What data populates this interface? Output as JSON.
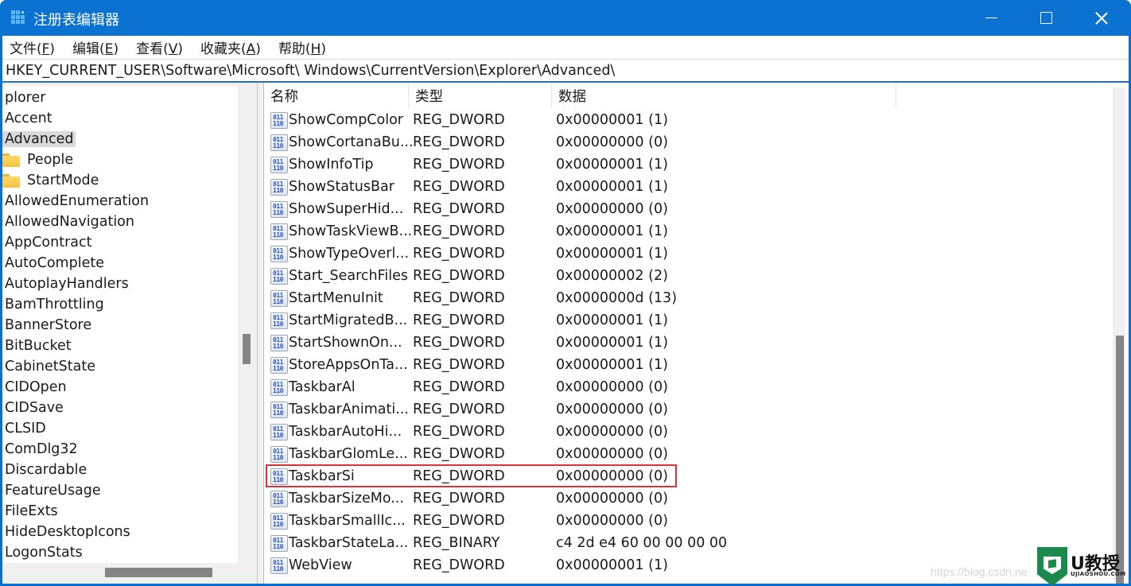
{
  "window": {
    "title": "注册表编辑器",
    "icon": "registry-editor-icon"
  },
  "menu": [
    {
      "label": "文件(",
      "key": "F",
      "suffix": ")"
    },
    {
      "label": "编辑(",
      "key": "E",
      "suffix": ")"
    },
    {
      "label": "查看(",
      "key": "V",
      "suffix": ")"
    },
    {
      "label": "收藏夹(",
      "key": "A",
      "suffix": ")"
    },
    {
      "label": "帮助(",
      "key": "H",
      "suffix": ")"
    }
  ],
  "address": "HKEY_CURRENT_USER\\Software\\Microsoft\\ Windows\\CurrentVersion\\Explorer\\Advanced\\",
  "tree": [
    {
      "label": "plorer",
      "folder": false,
      "selected": false
    },
    {
      "label": "Accent",
      "folder": false,
      "selected": false
    },
    {
      "label": "Advanced",
      "folder": false,
      "selected": true
    },
    {
      "label": "People",
      "folder": true,
      "selected": false
    },
    {
      "label": "StartMode",
      "folder": true,
      "selected": false
    },
    {
      "label": "AllowedEnumeration",
      "folder": false,
      "selected": false
    },
    {
      "label": "AllowedNavigation",
      "folder": false,
      "selected": false
    },
    {
      "label": "AppContract",
      "folder": false,
      "selected": false
    },
    {
      "label": "AutoComplete",
      "folder": false,
      "selected": false
    },
    {
      "label": "AutoplayHandlers",
      "folder": false,
      "selected": false
    },
    {
      "label": "BamThrottling",
      "folder": false,
      "selected": false
    },
    {
      "label": "BannerStore",
      "folder": false,
      "selected": false
    },
    {
      "label": "BitBucket",
      "folder": false,
      "selected": false
    },
    {
      "label": "CabinetState",
      "folder": false,
      "selected": false
    },
    {
      "label": "CIDOpen",
      "folder": false,
      "selected": false
    },
    {
      "label": "CIDSave",
      "folder": false,
      "selected": false
    },
    {
      "label": "CLSID",
      "folder": false,
      "selected": false
    },
    {
      "label": "ComDlg32",
      "folder": false,
      "selected": false
    },
    {
      "label": "Discardable",
      "folder": false,
      "selected": false
    },
    {
      "label": "FeatureUsage",
      "folder": false,
      "selected": false
    },
    {
      "label": "FileExts",
      "folder": false,
      "selected": false
    },
    {
      "label": "HideDesktopIcons",
      "folder": false,
      "selected": false
    },
    {
      "label": "LogonStats",
      "folder": false,
      "selected": false
    }
  ],
  "columns": {
    "name": "名称",
    "type": "类型",
    "data": "数据"
  },
  "values": [
    {
      "name": "ShowCompColor",
      "type": "REG_DWORD",
      "data": "0x00000001 (1)"
    },
    {
      "name": "ShowCortanaBu...",
      "type": "REG_DWORD",
      "data": "0x00000000 (0)"
    },
    {
      "name": "ShowInfoTip",
      "type": "REG_DWORD",
      "data": "0x00000001 (1)"
    },
    {
      "name": "ShowStatusBar",
      "type": "REG_DWORD",
      "data": "0x00000001 (1)"
    },
    {
      "name": "ShowSuperHid...",
      "type": "REG_DWORD",
      "data": "0x00000000 (0)"
    },
    {
      "name": "ShowTaskViewB...",
      "type": "REG_DWORD",
      "data": "0x00000001 (1)"
    },
    {
      "name": "ShowTypeOverl...",
      "type": "REG_DWORD",
      "data": "0x00000001 (1)"
    },
    {
      "name": "Start_SearchFiles",
      "type": "REG_DWORD",
      "data": "0x00000002 (2)"
    },
    {
      "name": "StartMenuInit",
      "type": "REG_DWORD",
      "data": "0x0000000d (13)"
    },
    {
      "name": "StartMigratedB...",
      "type": "REG_DWORD",
      "data": "0x00000001 (1)"
    },
    {
      "name": "StartShownOn...",
      "type": "REG_DWORD",
      "data": "0x00000001 (1)"
    },
    {
      "name": "StoreAppsOnTa...",
      "type": "REG_DWORD",
      "data": "0x00000001 (1)"
    },
    {
      "name": "TaskbarAl",
      "type": "REG_DWORD",
      "data": "0x00000000 (0)"
    },
    {
      "name": "TaskbarAnimati...",
      "type": "REG_DWORD",
      "data": "0x00000000 (0)"
    },
    {
      "name": "TaskbarAutoHi...",
      "type": "REG_DWORD",
      "data": "0x00000000 (0)"
    },
    {
      "name": "TaskbarGlomLe...",
      "type": "REG_DWORD",
      "data": "0x00000000 (0)"
    },
    {
      "name": "TaskbarSi",
      "type": "REG_DWORD",
      "data": "0x00000000 (0)",
      "highlighted": true
    },
    {
      "name": "TaskbarSizeMo...",
      "type": "REG_DWORD",
      "data": "0x00000000 (0)"
    },
    {
      "name": "TaskbarSmallIc...",
      "type": "REG_DWORD",
      "data": "0x00000000 (0)"
    },
    {
      "name": "TaskbarStateLa...",
      "type": "REG_BINARY",
      "data": "c4 2d e4 60 00 00 00 00"
    },
    {
      "name": "WebView",
      "type": "REG_DWORD",
      "data": "0x00000001 (1)"
    }
  ],
  "highlight_color": "#d9343a",
  "accent_color": "#0b72d1",
  "watermark": {
    "url": "https://blog.csdn.ne",
    "logo_text": "U教授",
    "logo_sub": "UJIAOSHOU.COM"
  }
}
